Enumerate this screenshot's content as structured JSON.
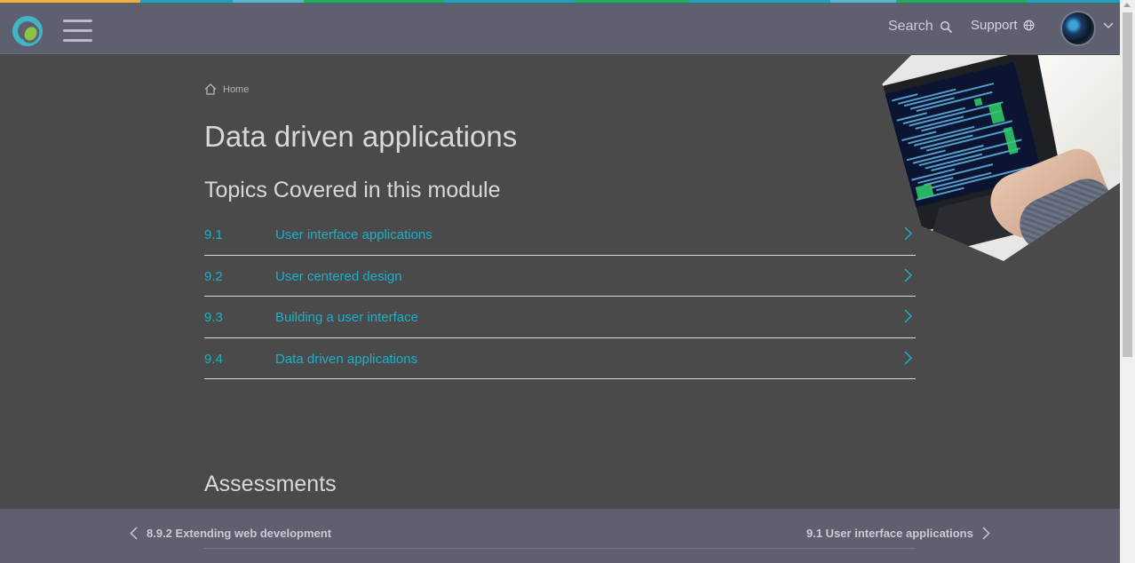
{
  "colors": {
    "accent": "#1ab0c8",
    "header_bg": "#5e6070",
    "page_bg": "#4a4a4a",
    "strip": [
      "#f2b035",
      "#1aa3c0",
      "#4fb9cf",
      "#19b25a",
      "#1aa3c0",
      "#19b25a",
      "#1aa3c0",
      "#4fb9cf",
      "#19b25a",
      "#1aa3c0"
    ]
  },
  "header": {
    "logo_icon": "ring-logo-icon",
    "menu_icon": "hamburger-menu-icon",
    "search_label": "Search",
    "search_icon": "search-icon",
    "support_label": "Support",
    "support_icon": "globe-icon",
    "avatar_icon": "user-avatar",
    "caret_icon": "chevron-down-icon"
  },
  "breadcrumb": {
    "home_icon": "home-icon",
    "home_label": "Home"
  },
  "page_title": "Data driven applications",
  "topics_section": {
    "title": "Topics Covered in this module",
    "items": [
      {
        "number": "9.1",
        "label": "User interface applications"
      },
      {
        "number": "9.2",
        "label": "User centered design"
      },
      {
        "number": "9.3",
        "label": "Building a user interface"
      },
      {
        "number": "9.4",
        "label": "Data driven applications"
      }
    ]
  },
  "assessments_title": "Assessments",
  "bottom_nav": {
    "prev_label": "8.9.2 Extending web development",
    "next_label": "9.1 User interface applications"
  }
}
